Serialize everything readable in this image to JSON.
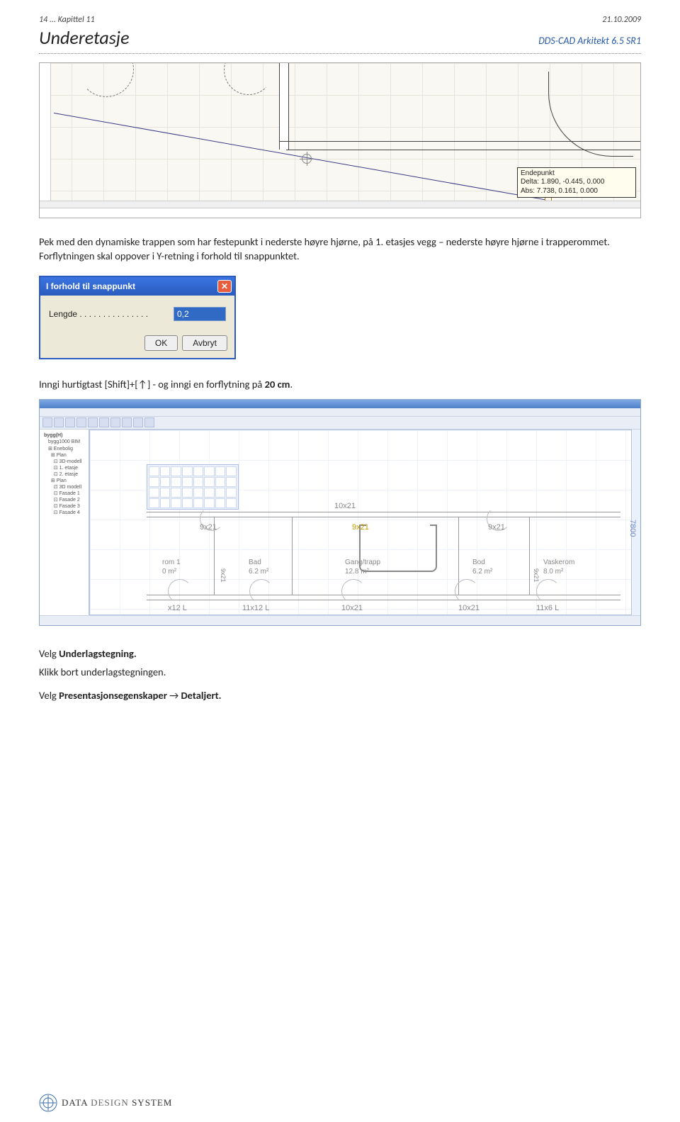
{
  "header": {
    "page_ref": "14 ... Kapittel 11",
    "date": "21.10.2009",
    "title": "Underetasje",
    "subtitle": "DDS-CAD Arkitekt  6.5 SR1"
  },
  "drawing1": {
    "tooltip_line1": "Endepunkt",
    "tooltip_line2": "Delta: 1.890, -0.445, 0.000",
    "tooltip_line3": "Abs: 7.738, 0.161, 0.000"
  },
  "paragraphs": {
    "p1": "Pek med den dynamiske trappen som har festepunkt i nederste høyre hjørne, på 1. etasjes vegg – nederste høyre hjørne i trapperommet. Forflytningen skal oppover i Y-retning i forhold til snappunktet.",
    "p2_a": "Inngi hurtigtast [Shift]+[",
    "p2_arrow": "↑",
    "p2_b": "] - og inngi en forflytning på ",
    "p2_bold": "20 cm",
    "p2_c": ".",
    "p3_a": "Velg ",
    "p3_bold": "Underlagstegning.",
    "p4": "Klikk bort underlagstegningen.",
    "p5_a": "Velg ",
    "p5_bold": "Presentasjonsegenskaper",
    "p5_arrow": " → ",
    "p5_bold2": "Detaljert."
  },
  "dialog": {
    "title": "I forhold til snappunkt",
    "length_label": "Lengde . . . . . . . . . . . . . . .",
    "length_value": "0,2",
    "ok": "OK",
    "cancel": "Avbryt"
  },
  "cad": {
    "doors": {
      "d1": "10x21",
      "d2": "9x21",
      "d3_sel": "9x21",
      "d4": "9x21",
      "b1": "x12 L",
      "b2": "11x12 L",
      "b3": "10x21",
      "b4": "10x21",
      "b5": "11x6 L"
    },
    "rooms": {
      "r1_name": "rom 1",
      "r1_area": "0 m²",
      "r2_name": "Bad",
      "r2_area": "6.2 m²",
      "r3_name": "Gang/trapp",
      "r3_area": "12.8 m²",
      "r4_name": "Bod",
      "r4_area": "6.2 m²",
      "r5_name": "Vaskerom",
      "r5_area": "8.0 m²"
    },
    "side_labels": {
      "s1": "9x21",
      "s2": "9x21"
    },
    "dim_v": "7800"
  },
  "footer": {
    "brand1": "DATA ",
    "brand2": "DESIGN ",
    "brand3": "SYSTEM"
  }
}
